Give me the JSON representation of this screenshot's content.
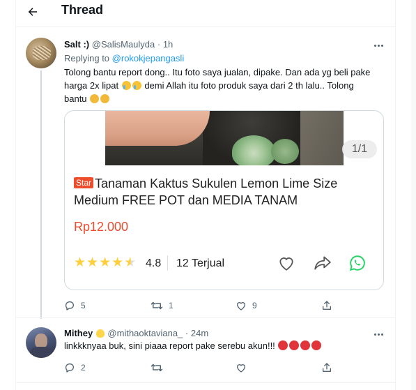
{
  "header": {
    "title": "Thread",
    "back_icon": "arrow-left-icon"
  },
  "main_tweet": {
    "display_name": "Salt :)",
    "handle": "@SalisMaulyda",
    "time": "· 1h",
    "replying_label": "Replying to",
    "replying_to": "@rokokjepangasli",
    "text_part1": "Tolong bantu report dong.. Itu foto saya jualan, dipake. Dan ada yg beli pake harga 2x lipat",
    "text_part2": "demi Allah itu foto produk saya dari 2 th lalu.. Tolong bantu",
    "emoji_after_part1": [
      "loudly-crying-face",
      "loudly-crying-face"
    ],
    "emoji_after_part2": [
      "disappointed-face",
      "disappointed-face"
    ],
    "card": {
      "image_counter": "1/1",
      "badge": "Star",
      "product_title": "Tanaman Kaktus Sukulen Lemon Lime Size Medium FREE POT dan MEDIA TANAM",
      "price": "Rp12.000",
      "stars": 4.5,
      "rating": "4.8",
      "sold": "12 Terjual",
      "price_color": "#ee4d2d",
      "star_color": "#ffce3d",
      "icons": [
        "heart-icon",
        "share-icon",
        "whatsapp-icon"
      ]
    },
    "actions": {
      "replies": "5",
      "retweets": "1",
      "likes": "9"
    }
  },
  "reply_tweet": {
    "display_name": "Mithey",
    "name_emoji": "hatching-chick",
    "handle": "@mithaoktaviana_",
    "time": "· 24m",
    "text": "linkkknyaa buk, sini piaaa report pake serebu akun!!!",
    "emoji_after_text": [
      "pouting-face",
      "pouting-face",
      "pouting-face",
      "pouting-face"
    ],
    "actions": {
      "replies": "2"
    }
  },
  "colors": {
    "accent": "#1d9bf0",
    "muted": "#536471",
    "text": "#0f1419"
  }
}
